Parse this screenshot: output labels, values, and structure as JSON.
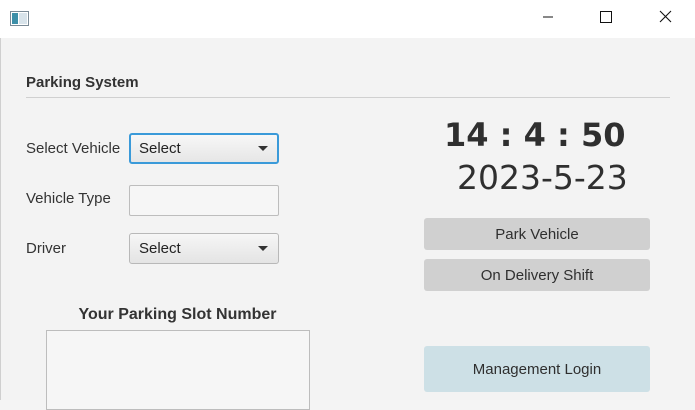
{
  "window": {
    "icon": "app-window-icon",
    "controls": [
      "minimize-icon",
      "maximize-icon",
      "close-icon"
    ]
  },
  "form": {
    "section_title": "Parking System",
    "select_vehicle_label": "Select Vehicle",
    "select_vehicle_value": "Select",
    "vehicle_type_label": "Vehicle Type",
    "vehicle_type_value": "",
    "driver_label": "Driver",
    "driver_value": "Select"
  },
  "clock": {
    "time": "14 : 4 : 50",
    "date": "2023-5-23"
  },
  "actions": {
    "park_vehicle": "Park Vehicle",
    "on_delivery_shift": "On Delivery Shift",
    "management_login": "Management Login"
  },
  "slot": {
    "title": "Your Parking Slot Number",
    "value": ""
  },
  "colors": {
    "focus_border": "#3a9ad9",
    "button_gray": "#d0d0d0",
    "management_button": "#cde0e6"
  }
}
